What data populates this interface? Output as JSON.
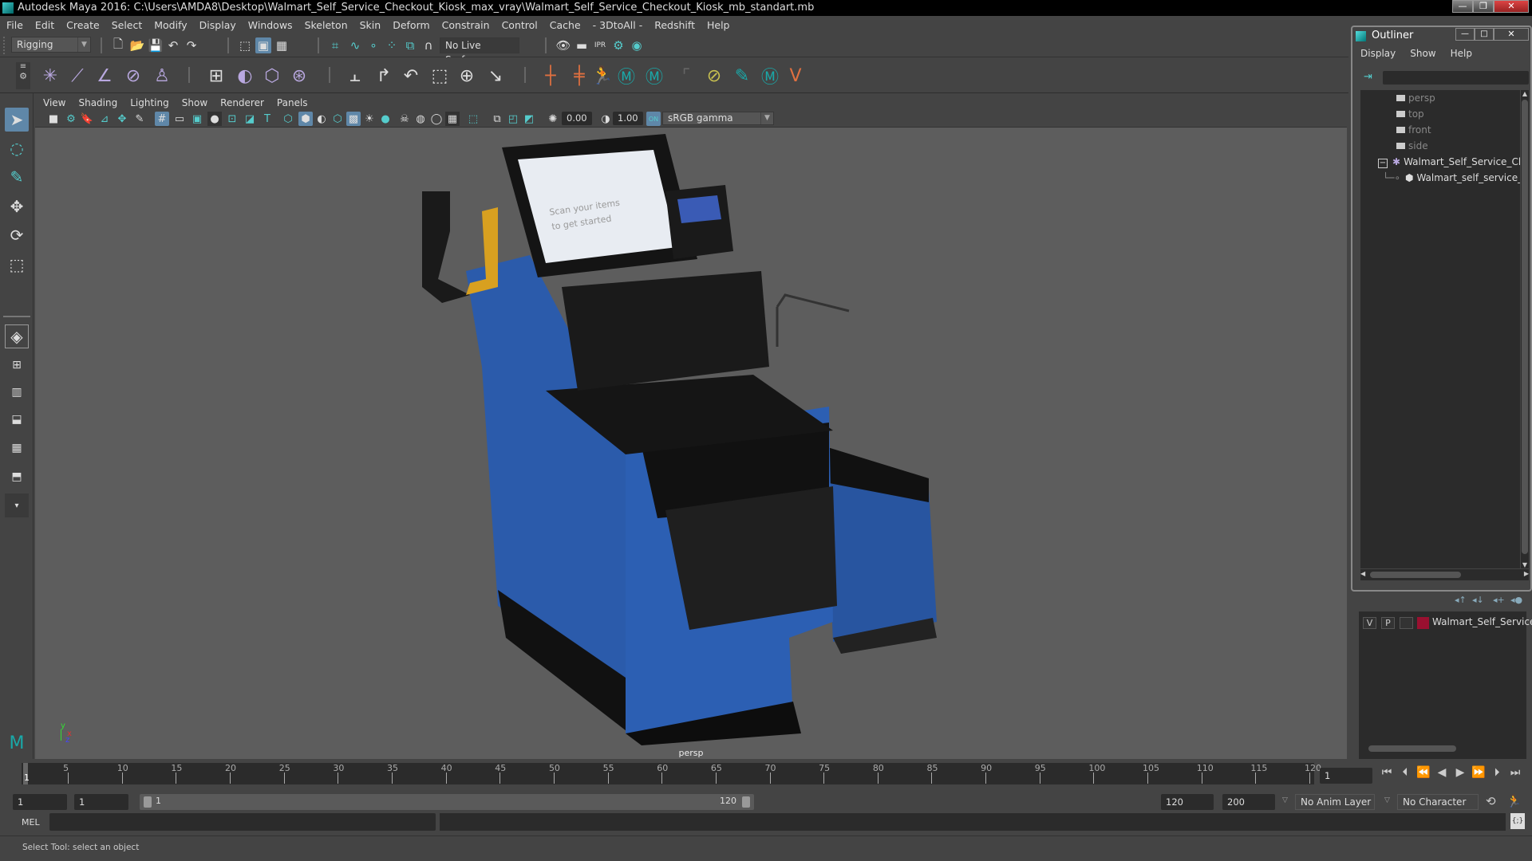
{
  "window": {
    "title": "Autodesk Maya 2016: C:\\Users\\AMDA8\\Desktop\\Walmart_Self_Service_Checkout_Kiosk_max_vray\\Walmart_Self_Service_Checkout_Kiosk_mb_standart.mb",
    "minimize": "—",
    "restore": "❐",
    "close": "✕"
  },
  "menubar": [
    "File",
    "Edit",
    "Create",
    "Select",
    "Modify",
    "Display",
    "Windows",
    "Skeleton",
    "Skin",
    "Deform",
    "Constrain",
    "Control",
    "Cache",
    "- 3DtoAll -",
    "Redshift",
    "Help"
  ],
  "status_line": {
    "menu_set": "Rigging",
    "live_surface": "No Live Surface"
  },
  "shelf": {
    "icons": [
      "joint-tool",
      "ik-handle",
      "ik-spline",
      "insert-joint",
      "humanik",
      "bind-skin",
      "paint-weights",
      "wrap",
      "skin-cluster",
      "parent-constraint",
      "point-constraint",
      "orient-constraint",
      "scale-constraint",
      "aim-constraint",
      "pole-vector",
      "cluster",
      "soft-mod",
      "character-controls",
      "mash-a",
      "mash-b",
      "blank",
      "deformer-set",
      "paint-select",
      "mash-c",
      "curve-v"
    ]
  },
  "toolbox": {
    "tools": [
      "select-tool",
      "lasso-tool",
      "paint-select-tool",
      "move-tool",
      "rotate-tool",
      "scale-tool"
    ],
    "layouts": [
      "single-pane",
      "four-pane",
      "outliner-persp",
      "persp-graph",
      "hypershade-persp",
      "persp-graph-outliner",
      "more"
    ]
  },
  "viewport": {
    "menu": [
      "View",
      "Shading",
      "Lighting",
      "Show",
      "Renderer",
      "Panels"
    ],
    "exposure": "0.00",
    "gamma": "1.00",
    "color_space": "sRGB gamma",
    "color_mgmt": "ON",
    "camera_label": "persp",
    "axis": {
      "x": "x",
      "y": "y",
      "z": "z"
    }
  },
  "outliner": {
    "title": "Outliner",
    "menu": [
      "Display",
      "Show",
      "Help"
    ],
    "items": [
      {
        "label": "persp",
        "type": "camera"
      },
      {
        "label": "top",
        "type": "camera"
      },
      {
        "label": "front",
        "type": "camera"
      },
      {
        "label": "side",
        "type": "camera"
      },
      {
        "label": "Walmart_Self_Service_Checkout_Kiosk",
        "type": "group",
        "expanded": true
      },
      {
        "label": "Walmart_self_service_kiosk",
        "type": "mesh"
      }
    ]
  },
  "layer_editor": {
    "layer": {
      "v": "V",
      "p": "P",
      "name": "Walmart_Self_Service_",
      "color": "#9a1030"
    }
  },
  "timeline": {
    "start": 1,
    "end": 120,
    "ticks": [
      5,
      10,
      15,
      20,
      25,
      30,
      35,
      40,
      45,
      50,
      55,
      60,
      65,
      70,
      75,
      80,
      85,
      90,
      95,
      100,
      105,
      110,
      115,
      120
    ],
    "current_frame": "1",
    "current_frame_marker": "1"
  },
  "range": {
    "anim_start": "1",
    "playback_start": "1",
    "range_start_label": "1",
    "range_end_label": "120",
    "playback_end": "120",
    "anim_end": "200",
    "anim_layer": "No Anim Layer",
    "character_set": "No Character Set"
  },
  "command_line": {
    "label": "MEL",
    "value": ""
  },
  "help_line": "Select Tool: select an object"
}
